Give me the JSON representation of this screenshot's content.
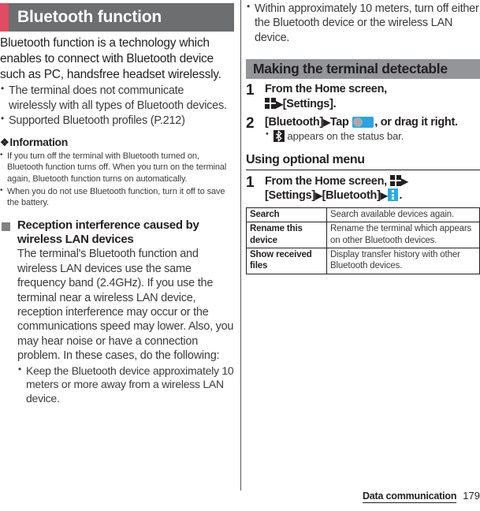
{
  "document": {
    "chapter_header": "Bluetooth function",
    "accent_color": "#e14b63",
    "header_bg_color": "#6d6e70",
    "banner_bg_color": "#939598"
  },
  "left_column": {
    "lead": "Bluetooth function is a technology which enables to connect with Bluetooth device such as PC, handsfree headset wirelessly.",
    "bullets": [
      "The terminal does not communicate wirelessly with all types of Bluetooth devices.",
      "Supported Bluetooth profiles (P.212)"
    ],
    "information": {
      "glyph": "❖",
      "title": "Information",
      "notes": [
        "If you turn off the terminal with Bluetooth turned on, Bluetooth function turns off. When you turn on the terminal again, Bluetooth function turns on automatically.",
        "When you do not use Bluetooth function, turn it off to save the battery."
      ]
    },
    "subsection": {
      "heading": "Reception interference caused by wireless LAN devices",
      "body": "The terminal's Bluetooth function and wireless LAN devices use the same frequency band (2.4GHz). If you use the terminal near a wireless LAN device, reception interference may occur or the communications speed may lower. Also, you may hear noise or have a connection problem. In these cases, do the following:",
      "bullets": [
        "Keep the Bluetooth device approximately 10 meters or more away from a wireless LAN device."
      ]
    }
  },
  "right_column": {
    "top_bullets": [
      "Within approximately 10 meters, turn off either the Bluetooth device or the wireless LAN device."
    ],
    "section_banner": "Making the terminal detectable",
    "steps": [
      {
        "number": "1",
        "text_before_icon": "From the Home screen, ",
        "icon": "app-grid-icon",
        "arrow": "▶",
        "text_after_icon": "[Settings].",
        "note": null
      },
      {
        "number": "2",
        "text_before_icon": "[Bluetooth]",
        "arrow": "▶",
        "text_mid": "Tap ",
        "icon": "toggle-switch-icon",
        "text_after_icon": ", or drag it right.",
        "note_icon": "bluetooth-status-icon",
        "note": " appears on the status bar."
      }
    ],
    "optional_menu": {
      "heading": "Using optional menu",
      "step": {
        "number": "1",
        "part1": "From the Home screen, ",
        "icon1": "app-grid-icon",
        "arrow1": "▶",
        "part2": "[Settings]",
        "arrow2": "▶",
        "part3": "[Bluetooth]",
        "arrow3": "▶",
        "icon2": "overflow-menu-icon",
        "part4": "."
      },
      "table": {
        "rows": [
          {
            "label": "Search",
            "description": "Search available devices again."
          },
          {
            "label": "Rename this device",
            "description": "Rename the terminal which appears on other Bluetooth devices."
          },
          {
            "label": "Show received files",
            "description": "Display transfer history with other Bluetooth devices."
          }
        ]
      }
    }
  },
  "footer": {
    "chapter_name": "Data communication",
    "page_number": "179"
  }
}
